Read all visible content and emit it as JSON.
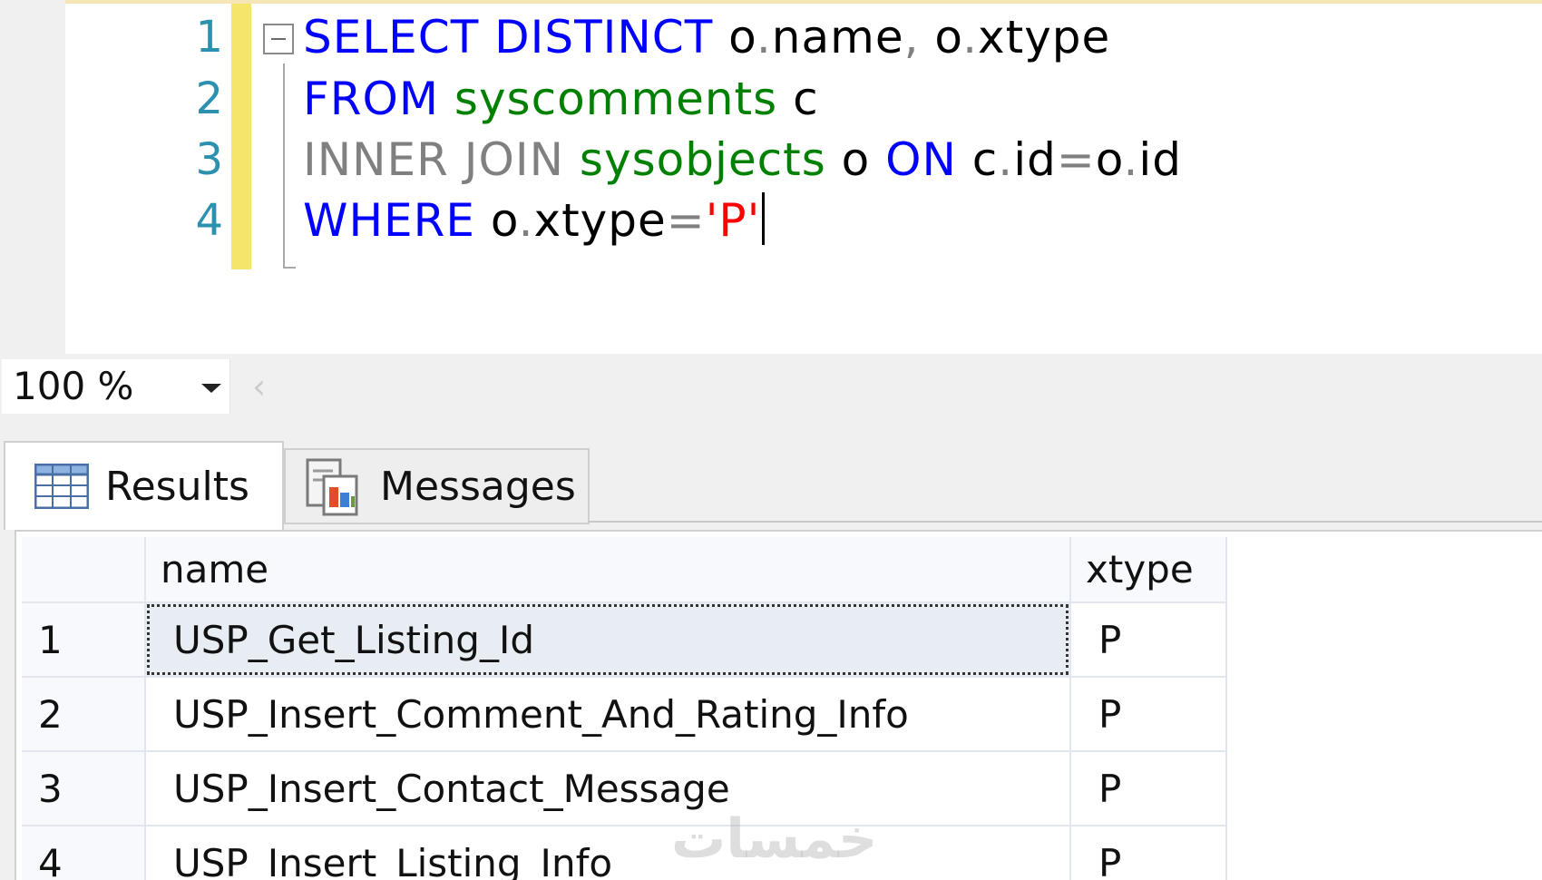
{
  "editor": {
    "lines": [
      {
        "number": "1",
        "tokens": [
          {
            "text": "SELECT DISTINCT",
            "kind": "kw"
          },
          {
            "text": " o",
            "kind": "plain"
          },
          {
            "text": ".",
            "kind": "op"
          },
          {
            "text": "name",
            "kind": "plain"
          },
          {
            "text": ",",
            "kind": "op"
          },
          {
            "text": " o",
            "kind": "plain"
          },
          {
            "text": ".",
            "kind": "op"
          },
          {
            "text": "xtype",
            "kind": "plain"
          }
        ]
      },
      {
        "number": "2",
        "tokens": [
          {
            "text": "FROM",
            "kind": "kw"
          },
          {
            "text": " syscomments",
            "kind": "obj"
          },
          {
            "text": " c",
            "kind": "plain"
          }
        ]
      },
      {
        "number": "3",
        "tokens": [
          {
            "text": "INNER JOIN",
            "kind": "op"
          },
          {
            "text": " sysobjects",
            "kind": "obj"
          },
          {
            "text": " o ",
            "kind": "plain"
          },
          {
            "text": "ON",
            "kind": "kw"
          },
          {
            "text": " c",
            "kind": "plain"
          },
          {
            "text": ".",
            "kind": "op"
          },
          {
            "text": "id",
            "kind": "plain"
          },
          {
            "text": "=",
            "kind": "op"
          },
          {
            "text": "o",
            "kind": "plain"
          },
          {
            "text": ".",
            "kind": "op"
          },
          {
            "text": "id",
            "kind": "plain"
          }
        ]
      },
      {
        "number": "4",
        "tokens": [
          {
            "text": "WHERE",
            "kind": "kw"
          },
          {
            "text": " o",
            "kind": "plain"
          },
          {
            "text": ".",
            "kind": "op"
          },
          {
            "text": "xtype",
            "kind": "plain"
          },
          {
            "text": "=",
            "kind": "op"
          },
          {
            "text": "'P'",
            "kind": "str"
          }
        ]
      }
    ]
  },
  "zoom": {
    "value": "100 %"
  },
  "tabs": {
    "results": "Results",
    "messages": "Messages"
  },
  "grid": {
    "columns": [
      "name",
      "xtype"
    ],
    "rows": [
      {
        "num": "1",
        "name": "USP_Get_Listing_Id",
        "xtype": "P"
      },
      {
        "num": "2",
        "name": "USP_Insert_Comment_And_Rating_Info",
        "xtype": "P"
      },
      {
        "num": "3",
        "name": "USP_Insert_Contact_Message",
        "xtype": "P"
      },
      {
        "num": "4",
        "name": "USP_Insert_Listing_Info",
        "xtype": "P"
      }
    ]
  },
  "watermark": "خمسات",
  "colors": {
    "keyword": "#0000ff",
    "object": "#008000",
    "operator": "#808080",
    "string": "#ff0000",
    "line_number": "#2b91af",
    "change_bar": "#f5e66b"
  },
  "icons": {
    "results_tab": "grid-icon",
    "messages_tab": "messages-icon"
  }
}
